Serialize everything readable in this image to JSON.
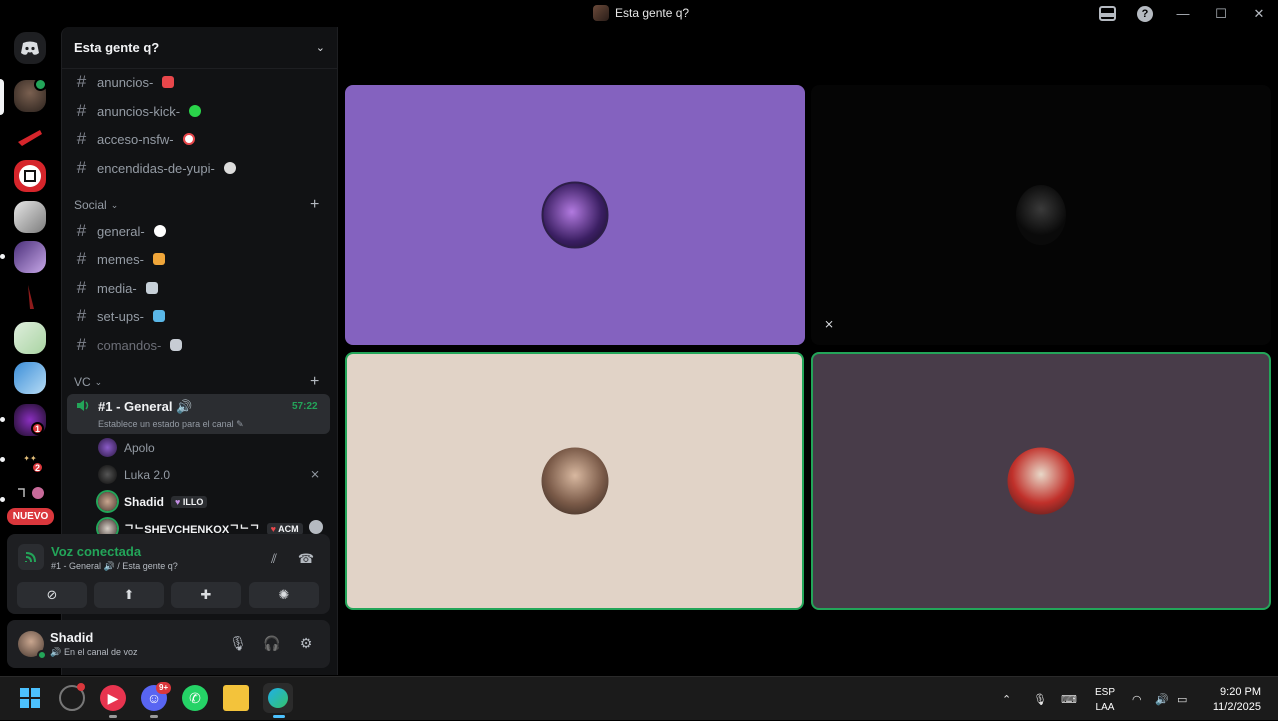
{
  "window": {
    "title": "Esta gente q?"
  },
  "rail": {
    "badge_1": "1",
    "badge_2": "2",
    "new_label": "NUEVO"
  },
  "guild": {
    "name": "Esta gente q?"
  },
  "channels_top": [
    {
      "name": "anuncios-",
      "emoji": "megaphone"
    },
    {
      "name": "anuncios-kick-",
      "emoji": "green-circle"
    },
    {
      "name": "acceso-nsfw-",
      "emoji": "no-entry"
    },
    {
      "name": "encendidas-de-yupi-",
      "emoji": "skull"
    }
  ],
  "categories": {
    "social": "Social",
    "vc": "VC"
  },
  "channels_social": [
    {
      "name": "general-",
      "emoji": "speech-bubble"
    },
    {
      "name": "memes-",
      "emoji": "cat"
    },
    {
      "name": "media-",
      "emoji": "camera"
    },
    {
      "name": "set-ups-",
      "emoji": "laptop"
    },
    {
      "name": "comandos-",
      "emoji": "robot"
    }
  ],
  "voice_channel": {
    "name": "#1 - General",
    "status_prompt": "Establece un estado para el canal",
    "timer": "57:22",
    "members": [
      {
        "name": "Apolo",
        "tag": ""
      },
      {
        "name": "Luka 2.0",
        "tag": ""
      },
      {
        "name": "Shadid",
        "tag": "ILLO"
      },
      {
        "name": "ᄀᄂSHEVCHENKOXᄀᄂᄀ",
        "tag": "ACM"
      }
    ]
  },
  "voice_panel": {
    "title": "Voz conectada",
    "subtitle": "#1 - General 🔊 / Esta gente q?"
  },
  "user": {
    "name": "Shadid",
    "status": "En el canal de voz"
  },
  "taskbar": {
    "discord_badge": "9+",
    "lang_top": "ESP",
    "lang_bottom": "LAA",
    "time": "9:20 PM",
    "date": "11/2/2025"
  },
  "colors": {
    "accent_green": "#23a559",
    "tile_purple": "#8462bf",
    "tile_beige": "#e1d3c7",
    "tile_plum": "#483c49",
    "danger": "#da373c"
  }
}
